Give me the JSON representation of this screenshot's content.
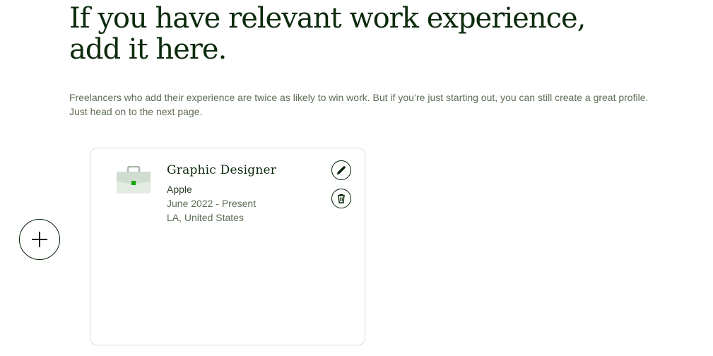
{
  "heading": {
    "line1": "If you have relevant work experience,",
    "line2": "add it here."
  },
  "description": {
    "line1": "Freelancers who add their experience are twice as likely to win work. But if you’re just starting out, you can still create a great profile.",
    "line2": "Just head on to the next page."
  },
  "add_button": {
    "icon": "plus-icon"
  },
  "experience_card": {
    "icon": "briefcase-icon",
    "title": "Graphic Designer",
    "company": "Apple",
    "dates": "June 2022 - Present",
    "location": "LA, United States",
    "actions": {
      "edit_icon": "pencil-icon",
      "delete_icon": "trash-icon"
    }
  },
  "colors": {
    "text_primary": "#001e00",
    "text_secondary": "#5e6d55",
    "card_border": "#d5e0d5",
    "briefcase_body": "#cfdccf",
    "briefcase_accent": "#14a800"
  }
}
